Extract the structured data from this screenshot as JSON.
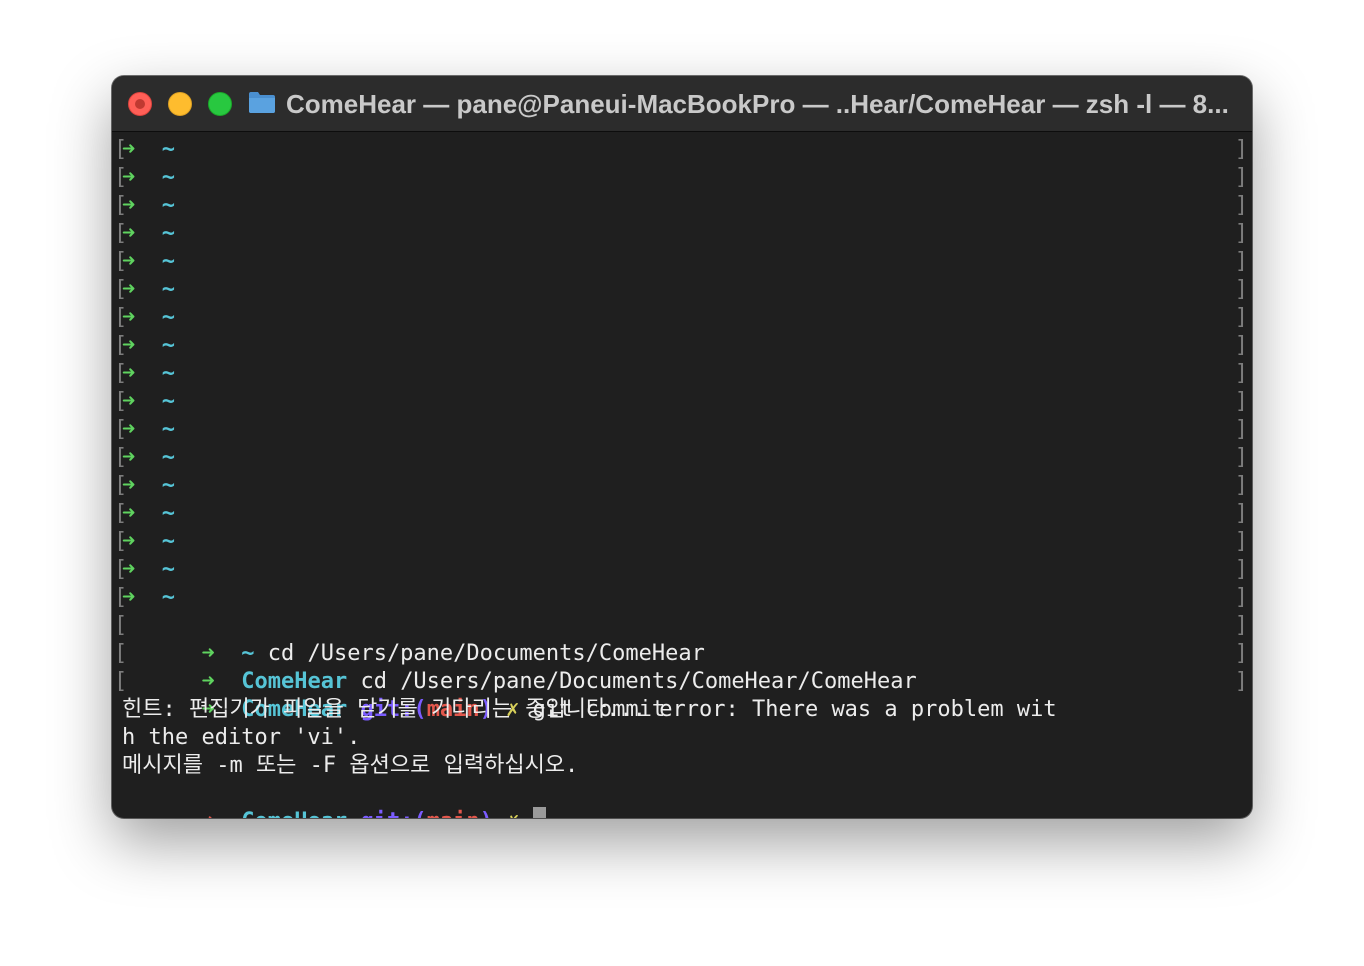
{
  "window": {
    "title": "ComeHear — pane@Paneui-MacBookPro — ..Hear/ComeHear — zsh -l — 8..."
  },
  "prompt": {
    "arrow": "➜",
    "home_dir": "~",
    "dir": "ComeHear",
    "git_prefix": "git:(",
    "branch": "main",
    "git_suffix": ")",
    "dirty_mark": "✗"
  },
  "history": {
    "empty_prompt_count": 17,
    "cmd1": "cd /Users/pane/Documents/ComeHear",
    "cmd2": "cd /Users/pane/Documents/ComeHear/ComeHear",
    "cmd3": "git commit"
  },
  "output": {
    "line1": "힌트: 편집기가 파일을 닫기를 기다리는 중입니다... error: There was a problem wit",
    "line2": "h the editor 'vi'.",
    "line3": "메시지를 -m 또는 -F 옵션으로 입력하십시오."
  },
  "colors": {
    "arrow_ok": "#5fd35f",
    "arrow_err": "#e2574c",
    "dir": "#56c4d6",
    "git": "#7b5cff",
    "branch": "#e2574c",
    "dirty": "#d8d05a"
  }
}
